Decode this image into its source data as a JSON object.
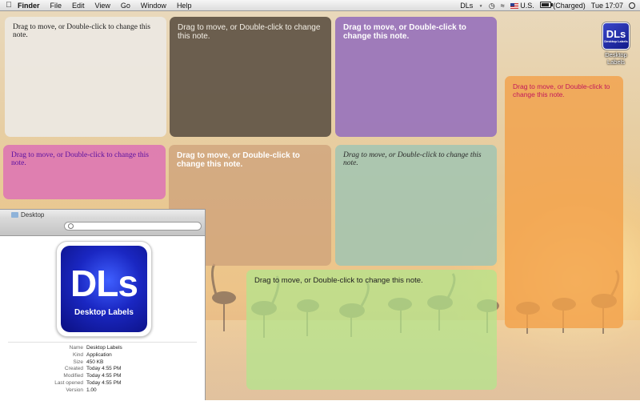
{
  "menubar": {
    "apple_icon": "apple-icon",
    "app_name": "Finder",
    "menus": [
      "File",
      "Edit",
      "View",
      "Go",
      "Window",
      "Help"
    ],
    "status": {
      "app_extra": "DLs",
      "input_source": "U.S.",
      "battery": "(Charged)",
      "clock": "Tue 17:07"
    }
  },
  "desktop_icon": {
    "logo_text": "DLs",
    "logo_subtext": "Desktop Labels",
    "label_line1": "Desktop",
    "label_line2": "Labels"
  },
  "notes": [
    {
      "text": "Drag to move, or Double-click to change this note.",
      "bg": "rgba(236,232,226,0.93)",
      "color": "#1a1a1a"
    },
    {
      "text": "Drag to move, or Double-click to change this note.",
      "bg": "rgba(102,90,74,0.97)",
      "color": "#f3efe6"
    },
    {
      "text": "Drag to move, or Double-click to change this note.",
      "bg": "rgba(155,118,186,0.95)",
      "color": "#ffffff"
    },
    {
      "text": "Drag to move, or Double-click to change this note.",
      "bg": "rgba(243,160,72,0.80)",
      "color": "#c2185b"
    },
    {
      "text": "Drag to move, or Double-click to change this note.",
      "bg": "rgba(221,120,178,0.92)",
      "color": "#5a0fa0"
    },
    {
      "text": "Drag to move, or Double-click to change this note.",
      "bg": "rgba(206,160,122,0.75)",
      "color": "#ffffff"
    },
    {
      "text": "Drag to move, or Double-click to change this note.",
      "bg": "rgba(156,196,180,0.80)",
      "color": "#2a2a2a"
    },
    {
      "text": "Drag to move, or Double-click to change this note.",
      "bg": "rgba(178,230,140,0.72)",
      "color": "#222222"
    }
  ],
  "finder": {
    "title": "Desktop",
    "logo_text": "DLs",
    "logo_subtext": "Desktop Labels",
    "info": [
      {
        "key": "Name",
        "value": "Desktop Labels"
      },
      {
        "key": "Kind",
        "value": "Application"
      },
      {
        "key": "Size",
        "value": "450 KB"
      },
      {
        "key": "Created",
        "value": "Today 4:55 PM"
      },
      {
        "key": "Modified",
        "value": "Today 4:55 PM"
      },
      {
        "key": "Last opened",
        "value": "Today 4:55 PM"
      },
      {
        "key": "Version",
        "value": "1.00"
      }
    ]
  }
}
